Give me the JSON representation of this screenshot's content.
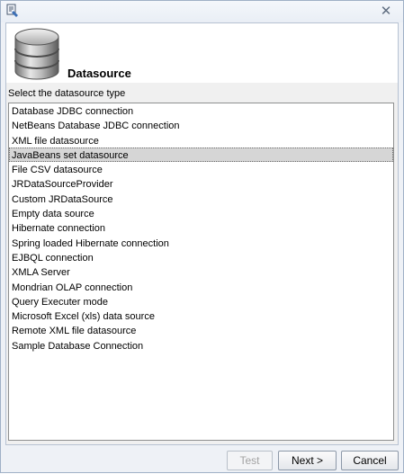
{
  "titlebar": {
    "close_glyph": "✕"
  },
  "header": {
    "icon": "database-icon",
    "title": "Datasource"
  },
  "prompt": "Select the datasource type",
  "datasource_types": [
    "Database JDBC connection",
    "NetBeans Database JDBC connection",
    "XML file datasource",
    "JavaBeans set datasource",
    "File CSV datasource",
    "JRDataSourceProvider",
    "Custom JRDataSource",
    "Empty data source",
    "Hibernate connection",
    "Spring loaded Hibernate connection",
    "EJBQL connection",
    "XMLA Server",
    "Mondrian OLAP connection",
    "Query Executer mode",
    "Microsoft Excel (xls) data source",
    "Remote XML file datasource",
    "Sample Database Connection"
  ],
  "selected_index": 3,
  "buttons": {
    "test": "Test",
    "next": "Next >",
    "cancel": "Cancel"
  },
  "colors": {
    "selection_bg": "#d6d6d6",
    "window_bg": "#eef1f6"
  }
}
